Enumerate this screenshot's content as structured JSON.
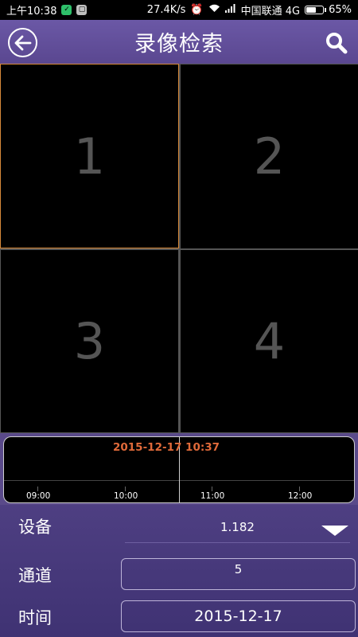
{
  "status_bar": {
    "time": "上午10:38",
    "speed": "27.4K/s",
    "carrier": "中国联通 4G",
    "battery": "65%",
    "battery_level": 0.65
  },
  "header": {
    "title": "录像检索",
    "back_icon": "back-arrow-circle-icon",
    "search_icon": "search-icon"
  },
  "grid": {
    "cells": [
      "1",
      "2",
      "3",
      "4"
    ],
    "selected_index": 0,
    "selected_color": "#d88a3a"
  },
  "timeline": {
    "current_datetime": "2015-12-17 10:37",
    "ticks": [
      "09:00",
      "10:00",
      "11:00",
      "12:00"
    ]
  },
  "form": {
    "device_label": "设备",
    "device_value": "1.182",
    "channel_label": "通道",
    "channel_value": "5",
    "time_label": "时间",
    "date_value": "2015-12-17"
  },
  "colors": {
    "header_bg": "#5f4c9a",
    "accent_orange": "#e06a3a"
  }
}
